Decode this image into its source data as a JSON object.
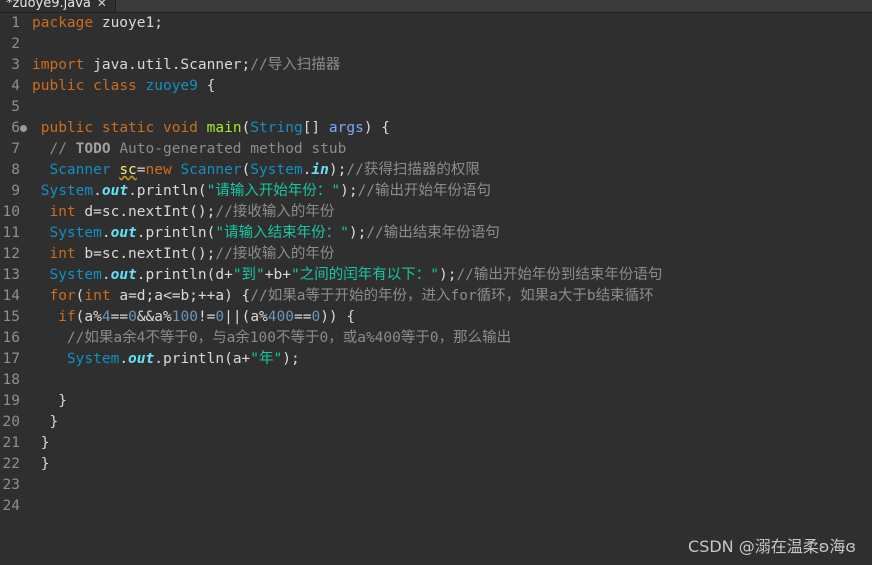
{
  "tab": {
    "title": "*zuoye9.java",
    "close_glyph": "✕"
  },
  "editor": {
    "lines": [
      {
        "num": "1",
        "tokens": [
          [
            "kw",
            "package"
          ],
          [
            "text",
            " zuoye1;"
          ]
        ]
      },
      {
        "num": "2",
        "tokens": []
      },
      {
        "num": "3",
        "tokens": [
          [
            "kw",
            "import"
          ],
          [
            "text",
            " java.util.Scanner;"
          ],
          [
            "comment",
            "//导入扫描器"
          ]
        ]
      },
      {
        "num": "4",
        "tokens": [
          [
            "kw",
            "public"
          ],
          [
            "text",
            " "
          ],
          [
            "kw",
            "class"
          ],
          [
            "text",
            " "
          ],
          [
            "type",
            "zuoye9"
          ],
          [
            "text",
            " {"
          ]
        ]
      },
      {
        "num": "5",
        "tokens": []
      },
      {
        "num": "6",
        "marker": true,
        "tokens": [
          [
            "text",
            " "
          ],
          [
            "kw",
            "public"
          ],
          [
            "text",
            " "
          ],
          [
            "kw",
            "static"
          ],
          [
            "text",
            " "
          ],
          [
            "kw",
            "void"
          ],
          [
            "text",
            " "
          ],
          [
            "fn",
            "main"
          ],
          [
            "text",
            "("
          ],
          [
            "type",
            "String"
          ],
          [
            "text",
            "[] "
          ],
          [
            "var",
            "args"
          ],
          [
            "text",
            ") {"
          ]
        ]
      },
      {
        "num": "7",
        "tokens": [
          [
            "text",
            "  "
          ],
          [
            "comment",
            "// "
          ],
          [
            "todo",
            "TODO"
          ],
          [
            "comment",
            " Auto-generated method stub"
          ]
        ]
      },
      {
        "num": "8",
        "tokens": [
          [
            "text",
            "  "
          ],
          [
            "type",
            "Scanner"
          ],
          [
            "text",
            " "
          ],
          [
            "squiggle",
            "sc"
          ],
          [
            "text",
            "="
          ],
          [
            "kw",
            "new"
          ],
          [
            "text",
            " "
          ],
          [
            "type",
            "Scanner"
          ],
          [
            "text",
            "("
          ],
          [
            "type",
            "System"
          ],
          [
            "text",
            "."
          ],
          [
            "field",
            "in"
          ],
          [
            "text",
            ");"
          ],
          [
            "comment",
            "//获得扫描器的权限"
          ]
        ]
      },
      {
        "num": "9",
        "tokens": [
          [
            "text",
            " "
          ],
          [
            "type",
            "System"
          ],
          [
            "text",
            "."
          ],
          [
            "field",
            "out"
          ],
          [
            "text",
            ".println("
          ],
          [
            "str",
            "\"请输入开始年份：\""
          ],
          [
            "text",
            ");"
          ],
          [
            "comment",
            "//输出开始年份语句"
          ]
        ]
      },
      {
        "num": "10",
        "tokens": [
          [
            "text",
            "  "
          ],
          [
            "kw",
            "int"
          ],
          [
            "text",
            " d=sc.nextInt();"
          ],
          [
            "comment",
            "//接收输入的年份"
          ]
        ]
      },
      {
        "num": "11",
        "tokens": [
          [
            "text",
            "  "
          ],
          [
            "type",
            "System"
          ],
          [
            "text",
            "."
          ],
          [
            "field",
            "out"
          ],
          [
            "text",
            ".println("
          ],
          [
            "str",
            "\"请输入结束年份：\""
          ],
          [
            "text",
            ");"
          ],
          [
            "comment",
            "//输出结束年份语句"
          ]
        ]
      },
      {
        "num": "12",
        "tokens": [
          [
            "text",
            "  "
          ],
          [
            "kw",
            "int"
          ],
          [
            "text",
            " b=sc.nextInt();"
          ],
          [
            "comment",
            "//接收输入的年份"
          ]
        ]
      },
      {
        "num": "13",
        "tokens": [
          [
            "text",
            "  "
          ],
          [
            "type",
            "System"
          ],
          [
            "text",
            "."
          ],
          [
            "field",
            "out"
          ],
          [
            "text",
            ".println(d+"
          ],
          [
            "str",
            "\"到\""
          ],
          [
            "text",
            "+b+"
          ],
          [
            "str",
            "\"之间的闰年有以下：\""
          ],
          [
            "text",
            ");"
          ],
          [
            "comment",
            "//输出开始年份到结束年份语句"
          ]
        ]
      },
      {
        "num": "14",
        "tokens": [
          [
            "text",
            "  "
          ],
          [
            "kw",
            "for"
          ],
          [
            "text",
            "("
          ],
          [
            "kw",
            "int"
          ],
          [
            "text",
            " a=d;a<=b;++a) {"
          ],
          [
            "comment",
            "//如果a等于开始的年份，进入for循环，如果a大于b结束循环"
          ]
        ]
      },
      {
        "num": "15",
        "tokens": [
          [
            "text",
            "   "
          ],
          [
            "kw",
            "if"
          ],
          [
            "text",
            "(a%"
          ],
          [
            "num",
            "4"
          ],
          [
            "text",
            "=="
          ],
          [
            "num",
            "0"
          ],
          [
            "text",
            "&&a%"
          ],
          [
            "num",
            "100"
          ],
          [
            "text",
            "!="
          ],
          [
            "num",
            "0"
          ],
          [
            "text",
            "||(a%"
          ],
          [
            "num",
            "400"
          ],
          [
            "text",
            "=="
          ],
          [
            "num",
            "0"
          ],
          [
            "text",
            ")) {"
          ]
        ]
      },
      {
        "num": "16",
        "tokens": [
          [
            "text",
            "    "
          ],
          [
            "comment",
            "//如果a余4不等于0，与a余100不等于0，或a%400等于0，那么输出"
          ]
        ]
      },
      {
        "num": "17",
        "tokens": [
          [
            "text",
            "    "
          ],
          [
            "type",
            "System"
          ],
          [
            "text",
            "."
          ],
          [
            "field",
            "out"
          ],
          [
            "text",
            ".println(a+"
          ],
          [
            "str",
            "\"年\""
          ],
          [
            "text",
            ");"
          ]
        ]
      },
      {
        "num": "18",
        "tokens": []
      },
      {
        "num": "19",
        "tokens": [
          [
            "text",
            "   }"
          ]
        ]
      },
      {
        "num": "20",
        "tokens": [
          [
            "text",
            "  }"
          ]
        ]
      },
      {
        "num": "21",
        "tokens": [
          [
            "text",
            " }"
          ]
        ]
      },
      {
        "num": "22",
        "tokens": [
          [
            "text",
            " }"
          ]
        ]
      },
      {
        "num": "23",
        "tokens": []
      },
      {
        "num": "24",
        "tokens": []
      }
    ]
  },
  "watermark": "CSDN @溺在温柔ʚ海ɞ"
}
